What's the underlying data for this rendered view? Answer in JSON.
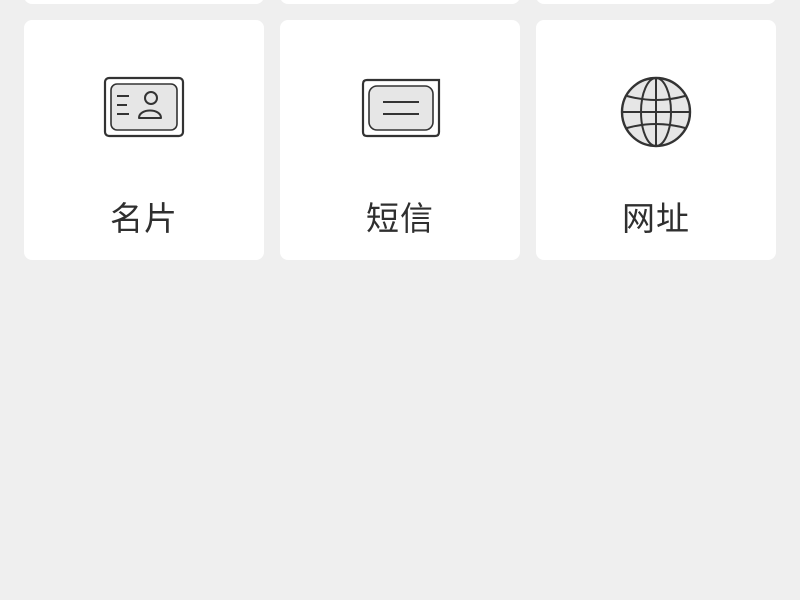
{
  "grid": {
    "items": [
      {
        "label": "名片",
        "icon": "business-card-icon"
      },
      {
        "label": "短信",
        "icon": "message-icon"
      },
      {
        "label": "网址",
        "icon": "globe-icon"
      }
    ]
  },
  "colors": {
    "background": "#efefef",
    "card": "#ffffff",
    "text": "#2f2f2f",
    "icon_stroke": "#333333",
    "icon_fill": "#e6e6e6"
  }
}
